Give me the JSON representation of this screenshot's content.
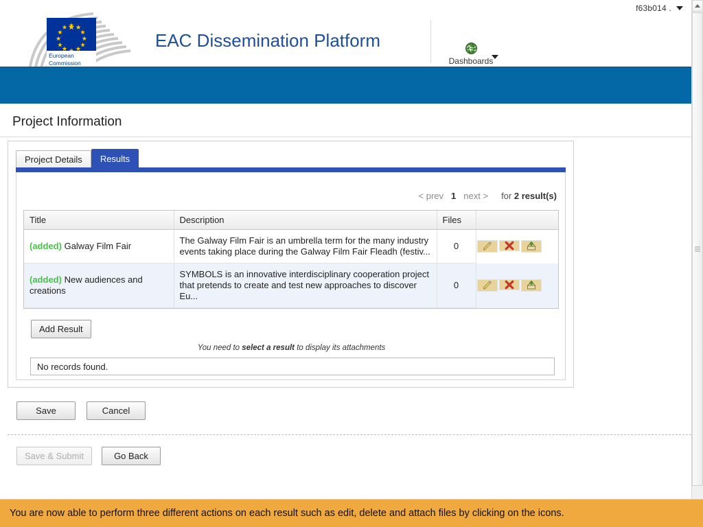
{
  "userbar": {
    "user_label": "f63b014 .",
    "caret_icon": "chevron-down-icon"
  },
  "header": {
    "logo_alt": "European Commission",
    "logo_line1": "European",
    "logo_line2": "Commission",
    "app_title": "EAC Dissemination Platform",
    "dashboards_label": "Dashboards",
    "dashboards_icon": "globe-icon",
    "brand_blue": "#0568a6",
    "title_color": "#1F4E96"
  },
  "page": {
    "title": "Project Information"
  },
  "tabs": [
    {
      "label": "Project Details",
      "active": false
    },
    {
      "label": "Results",
      "active": true
    }
  ],
  "pagination": {
    "prev": "< prev",
    "current": "1",
    "next": "next >",
    "for_label": "for",
    "count_label": "2 result(s)"
  },
  "results_table": {
    "columns": [
      "Title",
      "Description",
      "Files",
      ""
    ],
    "rows": [
      {
        "status": "(added)",
        "title": "Galway Film Fair",
        "description": "The Galway Film Fair is an umbrella term for the many industry events taking place during the Galway Film Fair Fleadh (festiv...",
        "files": "0",
        "actions": [
          "edit-icon",
          "delete-icon",
          "attach-icon"
        ]
      },
      {
        "status": "(added)",
        "title": "New audiences and creations",
        "description": "SYMBOLS is an innovative interdisciplinary cooperation project that pretends to create and test new approaches to discover Eu...",
        "files": "0",
        "actions": [
          "edit-icon",
          "delete-icon",
          "attach-icon"
        ]
      }
    ]
  },
  "add_result_button": "Add Result",
  "attachments": {
    "hint_prefix": "You need to ",
    "hint_bold": "select a result",
    "hint_suffix": " to display its attachments",
    "empty_message": "No records found."
  },
  "footer": {
    "save": "Save",
    "cancel": "Cancel",
    "save_submit": "Save & Submit",
    "go_back": "Go Back"
  },
  "banner": {
    "text": "You are now able to perform three different actions on each result such as edit, delete and attach files by clicking on the icons.",
    "color": "#efa93e"
  }
}
